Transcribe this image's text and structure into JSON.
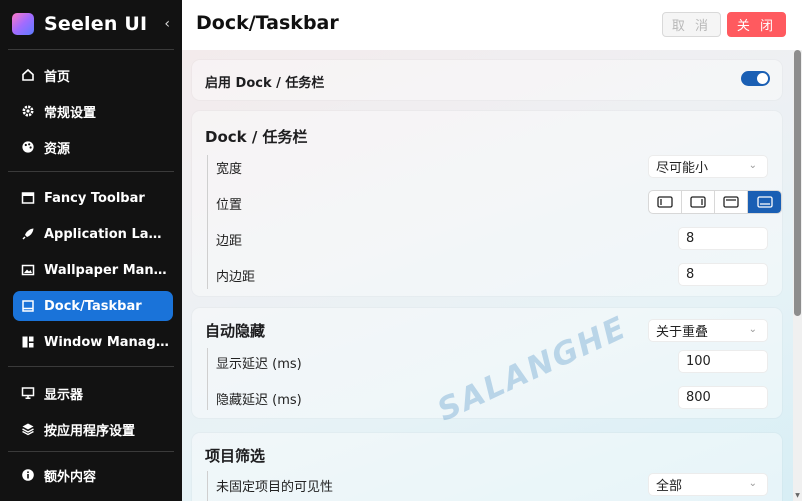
{
  "app": {
    "title": "Seelen UI",
    "collapse_icon": "chevron-left-icon"
  },
  "sidebar": {
    "items": [
      {
        "label": "首页",
        "icon": "home-icon"
      },
      {
        "label": "常规设置",
        "icon": "gear-icon"
      },
      {
        "label": "资源",
        "icon": "palette-icon"
      },
      {
        "label": "Fancy Toolbar",
        "icon": "toolbar-icon"
      },
      {
        "label": "Application Launcher",
        "icon": "rocket-icon"
      },
      {
        "label": "Wallpaper Manager",
        "icon": "wallpaper-icon"
      },
      {
        "label": "Dock/Taskbar",
        "icon": "dock-icon",
        "active": true
      },
      {
        "label": "Window Manager",
        "icon": "window-manager-icon"
      },
      {
        "label": "显示器",
        "icon": "monitor-icon"
      },
      {
        "label": "按应用程序设置",
        "icon": "layers-icon"
      },
      {
        "label": "额外内容",
        "icon": "info-icon"
      }
    ],
    "active_color": "#1a73d9"
  },
  "header": {
    "title": "Dock/Taskbar",
    "cancel_label": "取 消",
    "close_label": "关 闭",
    "close_color": "#ff5a5f"
  },
  "main": {
    "enable": {
      "label": "启用 Dock / 任务栏",
      "value": true
    },
    "dock_section": {
      "title": "Dock / 任务栏",
      "width_label": "宽度",
      "width_value": "尽可能小",
      "position_label": "位置",
      "position_options": [
        "left",
        "right",
        "top",
        "bottom"
      ],
      "position_selected": "bottom",
      "margin_label": "边距",
      "margin_value": "8",
      "padding_label": "内边距",
      "padding_value": "8"
    },
    "autohide_section": {
      "title": "自动隐藏",
      "mode_value": "关于重叠",
      "show_delay_label": "显示延迟 (ms)",
      "show_delay_value": "100",
      "hide_delay_label": "隐藏延迟 (ms)",
      "hide_delay_value": "800"
    },
    "filter_section": {
      "title": "项目筛选",
      "unpinned_visibility_label": "未固定项目的可见性",
      "unpinned_visibility_value": "全部"
    }
  },
  "watermark": "SALANGHE",
  "accent_color": "#1a5fb4"
}
